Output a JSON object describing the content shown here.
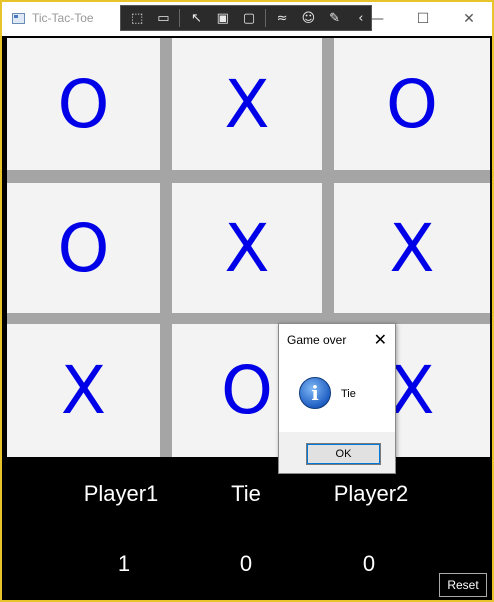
{
  "window": {
    "title": "Tic-Tac-Toe",
    "controls": {
      "minimize": "—",
      "maximize": "☐",
      "close": "✕"
    }
  },
  "toolbar_icons": [
    "select-region-icon",
    "video-icon",
    "pointer-icon",
    "square-icon",
    "screen-icon",
    "wave-icon",
    "accessibility-icon",
    "pen-icon",
    "collapse-icon"
  ],
  "toolbar_glyphs": [
    "⬚",
    "▭",
    "↖",
    "▣",
    "▢",
    "≈",
    "☺",
    "✎",
    "‹"
  ],
  "board": {
    "cells": [
      "O",
      "X",
      "O",
      "O",
      "X",
      "X",
      "X",
      "O",
      "X"
    ]
  },
  "scores": {
    "headers": [
      "Player1",
      "Tie",
      "Player2"
    ],
    "values": [
      "1",
      "0",
      "0"
    ]
  },
  "reset_label": "Reset",
  "dialog": {
    "title": "Game over",
    "close": "✕",
    "icon_glyph": "i",
    "message": "Tie",
    "ok_label": "OK"
  },
  "colors": {
    "mark": "#0000e8",
    "grid": "#a5a5a5",
    "cell": "#f3f3f3",
    "window_border": "#e6c42a"
  }
}
